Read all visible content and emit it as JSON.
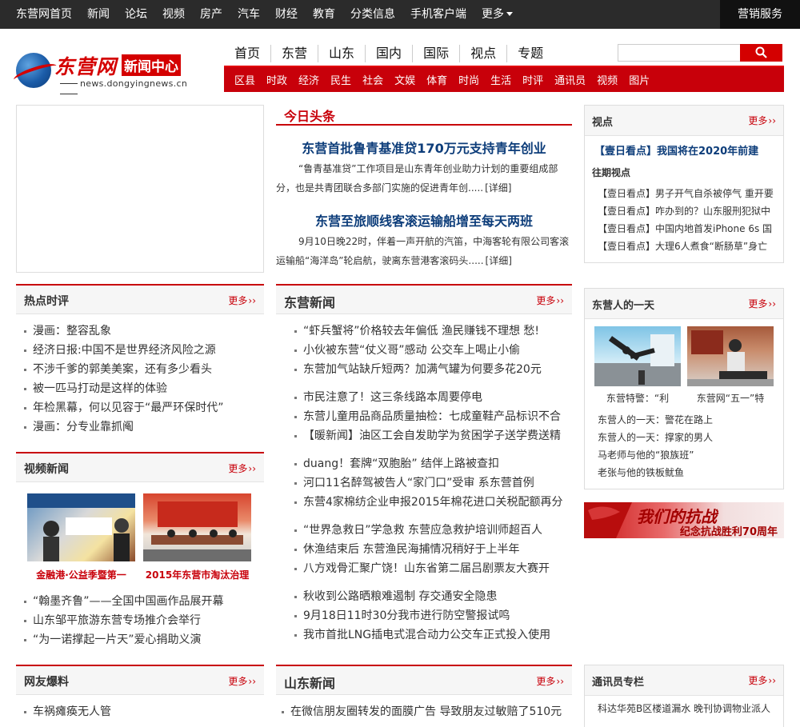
{
  "topnav": {
    "items": [
      "东营网首页",
      "新闻",
      "论坛",
      "视频",
      "房产",
      "汽车",
      "财经",
      "教育",
      "分类信息",
      "手机客户端",
      "更多"
    ],
    "marketing": "营销服务"
  },
  "logo": {
    "name": "东营网",
    "box": "新闻中心",
    "url": "news.dongyingnews.cn"
  },
  "mainnav": [
    "首页",
    "东营",
    "山东",
    "国内",
    "国际",
    "视点",
    "专题"
  ],
  "subnav": [
    "区县",
    "时政",
    "经济",
    "民生",
    "社会",
    "文娱",
    "体育",
    "时尚",
    "生活",
    "时评",
    "通讯员",
    "视频",
    "图片"
  ],
  "search": {
    "value": ""
  },
  "today": {
    "title": "今日头条",
    "items": [
      {
        "headline": "东营首批鲁青基准贷170万元支持青年创业",
        "summary": "“鲁青基准贷”工作项目是山东青年创业助力计划的重要组成部分，也是共青团联合多部门实施的促进青年创.....",
        "detail": "[详细]"
      },
      {
        "headline": "东营至旅顺线客滚运输船增至每天两班",
        "summary": "9月10日晚22时，伴着一声开航的汽笛，中海客轮有限公司客滚运输船“海洋岛”轮启航，驶离东营港客滚码头.....",
        "detail": "[详细]"
      }
    ]
  },
  "hotcomment": {
    "title": "热点时评",
    "more": "更多",
    "items": [
      "漫画：整容乱象",
      "经济日报:中国不是世界经济风险之源",
      "不涉千爹的郭美美案，还有多少看头",
      "被一匹马打动是这样的体验",
      "年检黑幕，何以见容于“最严环保时代”",
      "漫画：分专业靠抓阄"
    ]
  },
  "videonews": {
    "title": "视频新闻",
    "more": "更多",
    "thumbs": [
      "金融港·公益季暨第一",
      "2015年东营市淘汰治理"
    ],
    "items": [
      "“翰墨齐鲁”——全国中国画作品展开幕",
      "山东邹平旅游东营专场推介会举行",
      "“为一诺撑起一片天”爱心捐助义演"
    ]
  },
  "wangyou": {
    "title": "网友爆料",
    "more": "更多",
    "items": [
      "车祸瘫痪无人管"
    ]
  },
  "dongying": {
    "title": "东营新闻",
    "more": "更多",
    "groups": [
      [
        "“虾兵蟹将”价格较去年偏低 渔民赚钱不理想 愁!",
        "小伙被东营“仗义哥”感动 公交车上喝止小偷",
        "东营加气站缺斤短两？加满气罐为何要多花20元"
      ],
      [
        "市民注意了！这三条线路本周要停电",
        "东营儿童用品商品质量抽检：七成童鞋产品标识不合",
        "【暖新闻】油区工会自发助学为贫困学子送学费送精"
      ],
      [
        "duang！套牌“双胞胎” 结伴上路被查扣",
        "河口11名醉驾被告人“家门口”受审 系东营首例",
        "东营4家棉纺企业申报2015年棉花进口关税配额再分"
      ],
      [
        "“世界急救日”学急救 东营应急救护培训师超百人",
        "休渔结束后 东营渔民海捕情况稍好于上半年",
        "八方戏骨汇聚广饶！山东省第二届吕剧票友大赛开"
      ],
      [
        "秋收到公路晒粮难遏制 存交通安全隐患",
        "9月18日11时30分我市进行防空警报试鸣",
        "我市首批LNG插电式混合动力公交车正式投入使用"
      ]
    ]
  },
  "shandong": {
    "title": "山东新闻",
    "more": "更多",
    "items": [
      "在微信朋友圈转发的面膜广告 导致朋友过敏赔了510元"
    ]
  },
  "viewpoint": {
    "title": "视点",
    "more": "更多",
    "lead": "【壹日看点】我国将在2020年前建",
    "past_label": "往期视点",
    "items": [
      "【壹日看点】男子开气自杀被停气 重开要",
      "【壹日看点】咋办到的？山东服刑犯狱中",
      "【壹日看点】中国内地首发iPhone 6s 国",
      "【壹日看点】大理6人煮食“断肠草”身亡"
    ]
  },
  "dayinlife": {
    "title": "东营人的一天",
    "more": "更多",
    "thumbs": [
      "东营特警：“利",
      "东营网“五一”特"
    ],
    "items": [
      "东营人的一天：警花在路上",
      "东营人的一天：撑家的男人",
      "马老师与他的“狼族班”",
      "老张与他的铁板鱿鱼"
    ]
  },
  "banner": {
    "line1": "我们的抗战",
    "line2": "纪念抗战胜利70周年"
  },
  "correspondent": {
    "title": "通讯员专栏",
    "more": "更多",
    "items": [
      "科达华苑B区楼道漏水 晚刊协调物业派人"
    ]
  },
  "colors": {
    "accent": "#c8000a",
    "headline": "#0d3d7a",
    "topbar": "#2b2b2b"
  }
}
